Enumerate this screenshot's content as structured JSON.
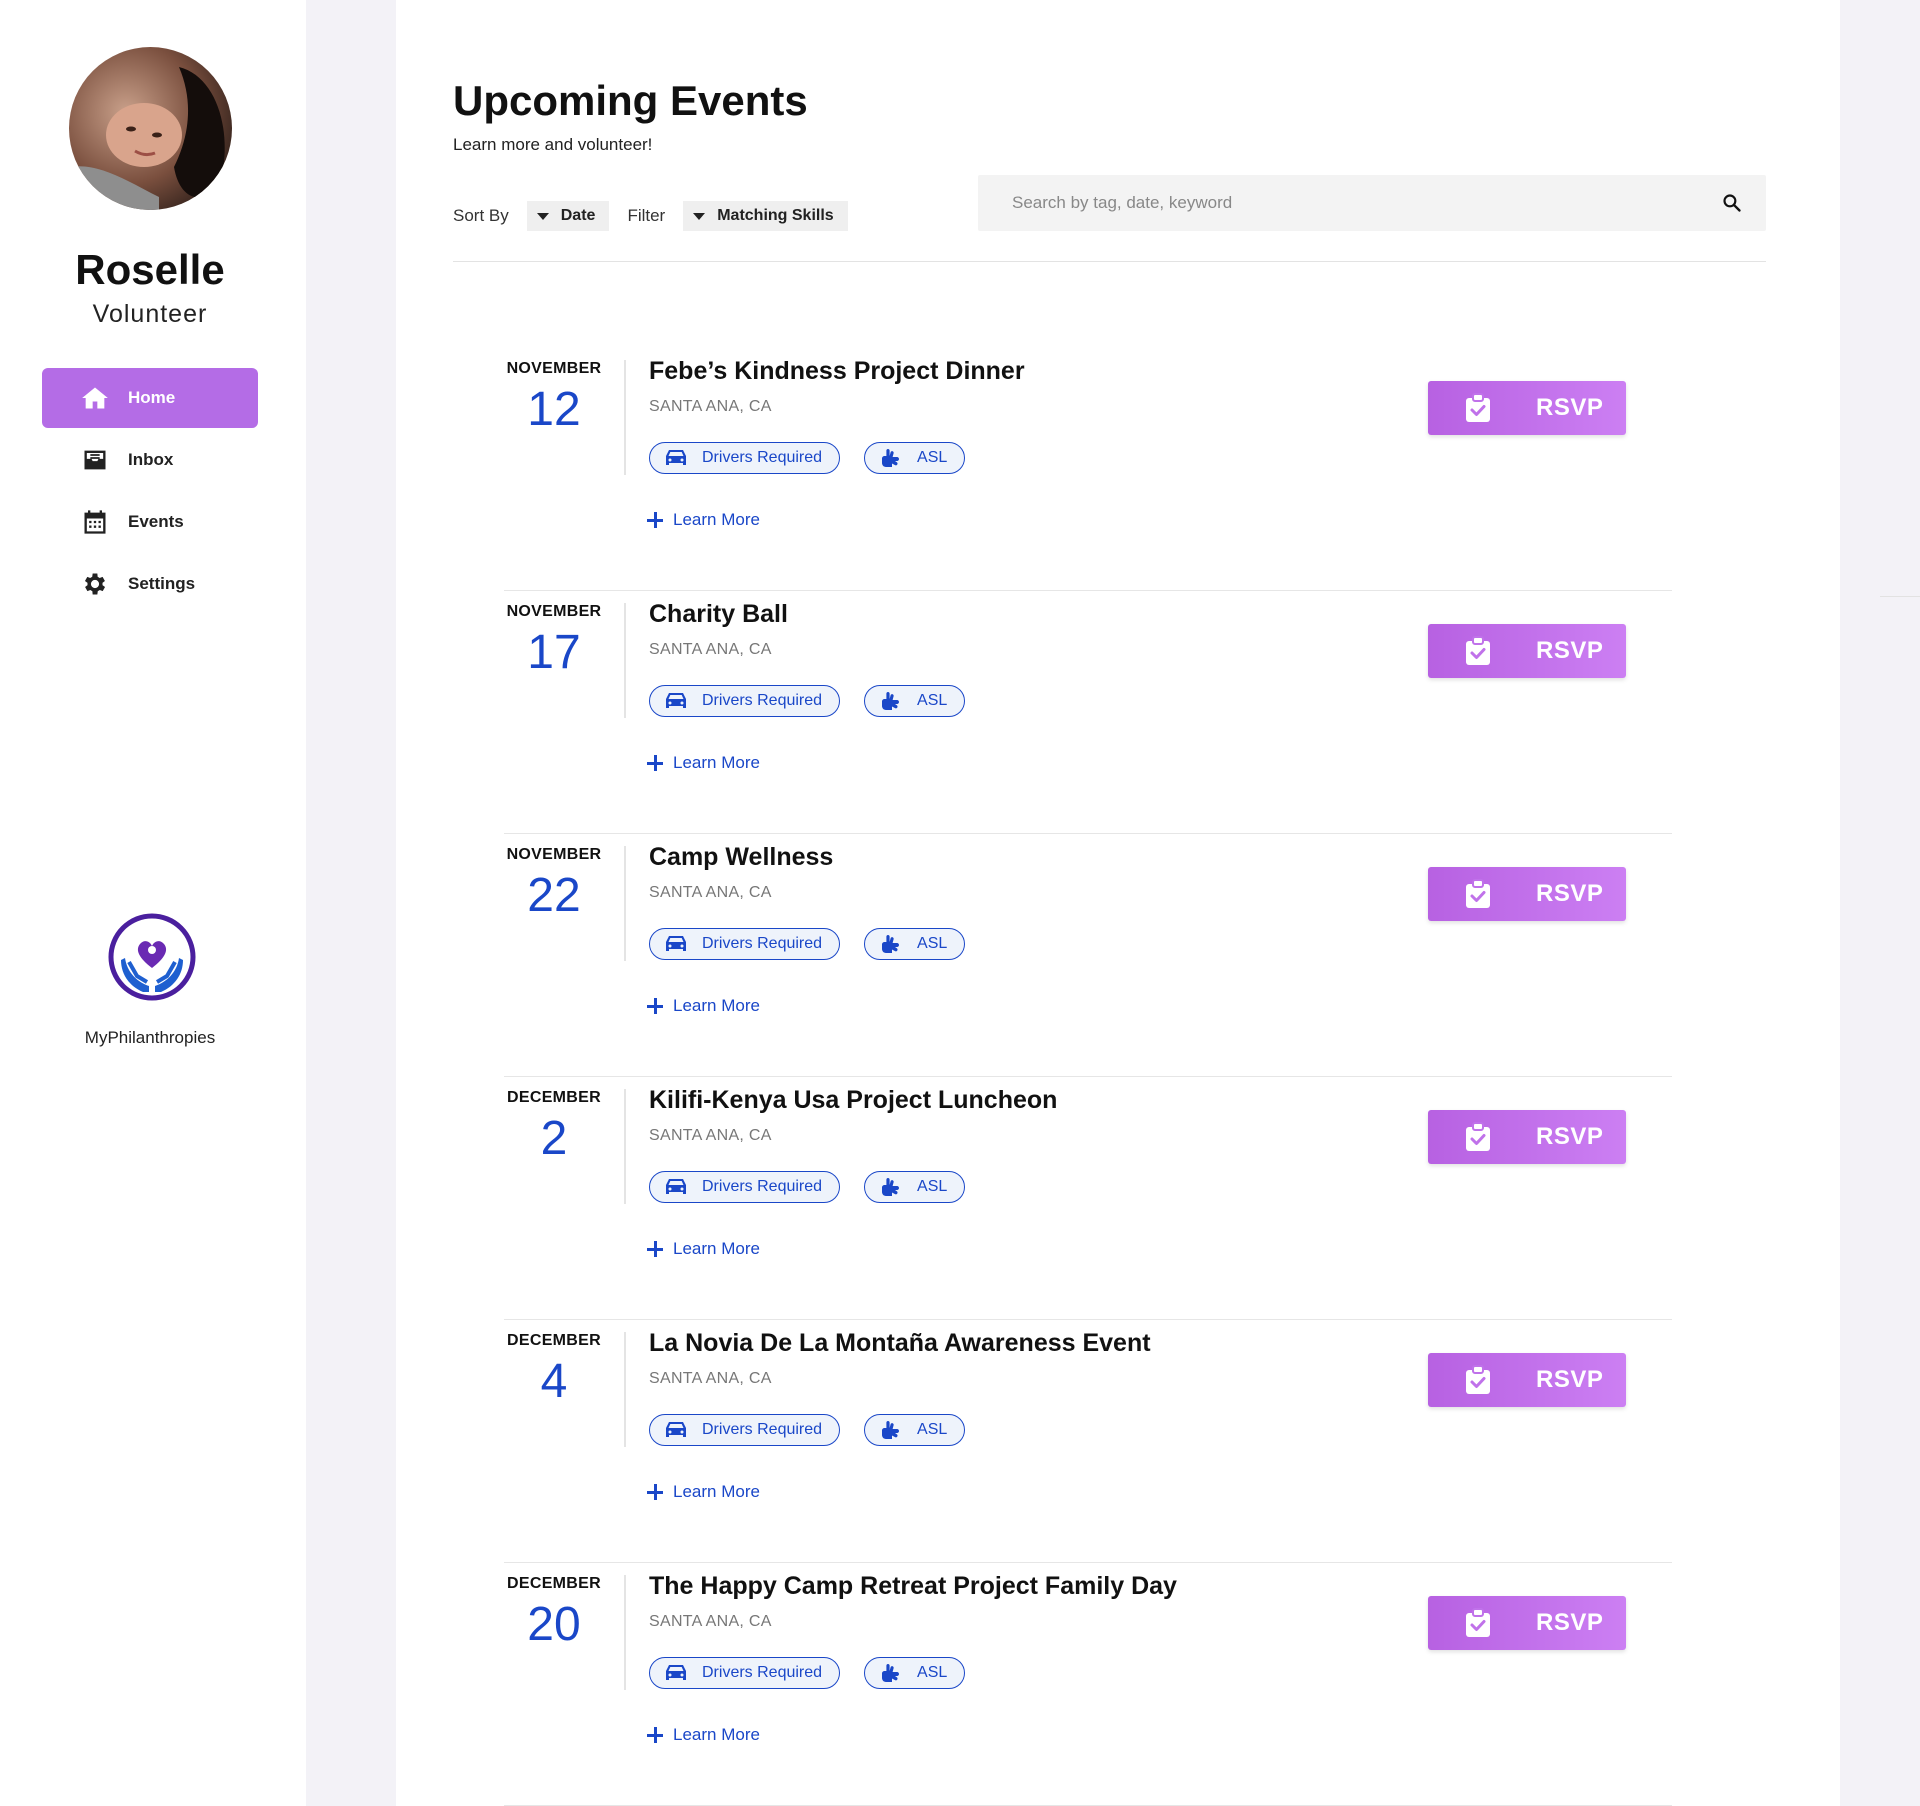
{
  "profile": {
    "name": "Roselle",
    "role": "Volunteer"
  },
  "nav": {
    "items": [
      {
        "label": "Home",
        "icon": "home-icon",
        "active": true
      },
      {
        "label": "Inbox",
        "icon": "inbox-icon",
        "active": false
      },
      {
        "label": "Events",
        "icon": "calendar-icon",
        "active": false
      },
      {
        "label": "Settings",
        "icon": "gear-icon",
        "active": false
      }
    ]
  },
  "brand": {
    "name": "MyPhilanthropies",
    "icon": "heart-hands-logo"
  },
  "header": {
    "title": "Upcoming Events",
    "subtitle": "Learn more and volunteer!"
  },
  "toolbar": {
    "sort_label": "Sort By",
    "sort_value": "Date",
    "filter_label": "Filter",
    "filter_value": "Matching Skills"
  },
  "search": {
    "placeholder": "Search by tag, date, keyword",
    "icon": "search-icon"
  },
  "colors": {
    "accent_purple": "#b46ce6",
    "link_blue": "#1a47c8",
    "background_gutter": "#f3f2f7"
  },
  "events": [
    {
      "month": "NOVEMBER",
      "day": "12",
      "title": "Febe’s Kindness Project Dinner",
      "location": "SANTA ANA, CA",
      "tags": [
        {
          "label": "Drivers Required",
          "icon": "car-icon"
        },
        {
          "label": "ASL",
          "icon": "sign-language-icon"
        }
      ],
      "learn_more": "Learn More",
      "rsvp": "RSVP"
    },
    {
      "month": "NOVEMBER",
      "day": "17",
      "title": "Charity Ball",
      "location": "SANTA ANA, CA",
      "tags": [
        {
          "label": "Drivers Required",
          "icon": "car-icon"
        },
        {
          "label": "ASL",
          "icon": "sign-language-icon"
        }
      ],
      "learn_more": "Learn More",
      "rsvp": "RSVP"
    },
    {
      "month": "NOVEMBER",
      "day": "22",
      "title": "Camp Wellness",
      "location": "SANTA ANA, CA",
      "tags": [
        {
          "label": "Drivers Required",
          "icon": "car-icon"
        },
        {
          "label": "ASL",
          "icon": "sign-language-icon"
        }
      ],
      "learn_more": "Learn More",
      "rsvp": "RSVP"
    },
    {
      "month": "DECEMBER",
      "day": "2",
      "title": "Kilifi-Kenya Usa Project Luncheon",
      "location": "SANTA ANA, CA",
      "tags": [
        {
          "label": "Drivers Required",
          "icon": "car-icon"
        },
        {
          "label": "ASL",
          "icon": "sign-language-icon"
        }
      ],
      "learn_more": "Learn More",
      "rsvp": "RSVP"
    },
    {
      "month": "DECEMBER",
      "day": "4",
      "title": "La Novia De La Montaña Awareness Event",
      "location": "SANTA ANA, CA",
      "tags": [
        {
          "label": "Drivers Required",
          "icon": "car-icon"
        },
        {
          "label": "ASL",
          "icon": "sign-language-icon"
        }
      ],
      "learn_more": "Learn More",
      "rsvp": "RSVP"
    },
    {
      "month": "DECEMBER",
      "day": "20",
      "title": "The Happy Camp Retreat Project Family Day",
      "location": "SANTA ANA, CA",
      "tags": [
        {
          "label": "Drivers Required",
          "icon": "car-icon"
        },
        {
          "label": "ASL",
          "icon": "sign-language-icon"
        }
      ],
      "learn_more": "Learn More",
      "rsvp": "RSVP"
    }
  ]
}
